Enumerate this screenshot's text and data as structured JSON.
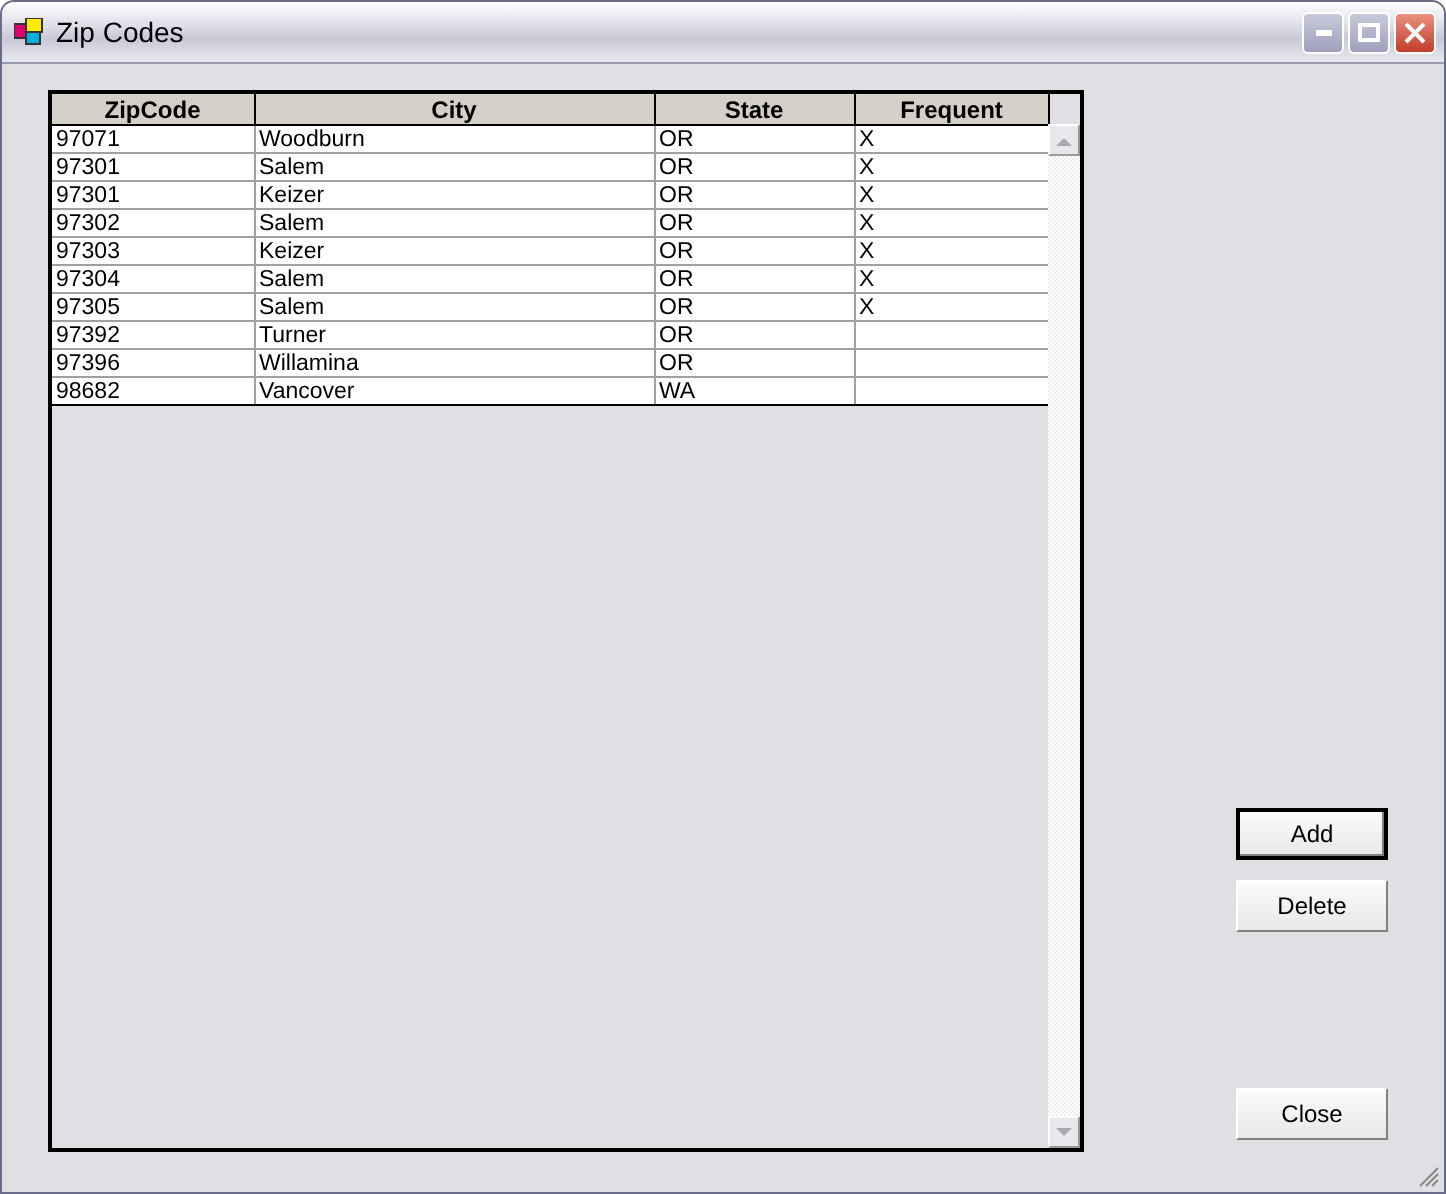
{
  "window": {
    "title": "Zip Codes"
  },
  "grid": {
    "columns": [
      "ZipCode",
      "City",
      "State",
      "Frequent"
    ],
    "rows": [
      [
        "97071",
        "Woodburn",
        "OR",
        "X"
      ],
      [
        "97301",
        "Salem",
        "OR",
        "X"
      ],
      [
        "97301",
        "Keizer",
        "OR",
        "X"
      ],
      [
        "97302",
        "Salem",
        "OR",
        "X"
      ],
      [
        "97303",
        "Keizer",
        "OR",
        "X"
      ],
      [
        "97304",
        "Salem",
        "OR",
        "X"
      ],
      [
        "97305",
        "Salem",
        "OR",
        "X"
      ],
      [
        "97392",
        "Turner",
        "OR",
        ""
      ],
      [
        "97396",
        "Willamina",
        "OR",
        ""
      ],
      [
        "98682",
        "Vancover",
        "WA",
        ""
      ]
    ]
  },
  "buttons": [
    {
      "label": "Add",
      "default": true
    },
    {
      "label": "Delete",
      "default": false
    },
    {
      "label": "Close",
      "default": false
    }
  ]
}
